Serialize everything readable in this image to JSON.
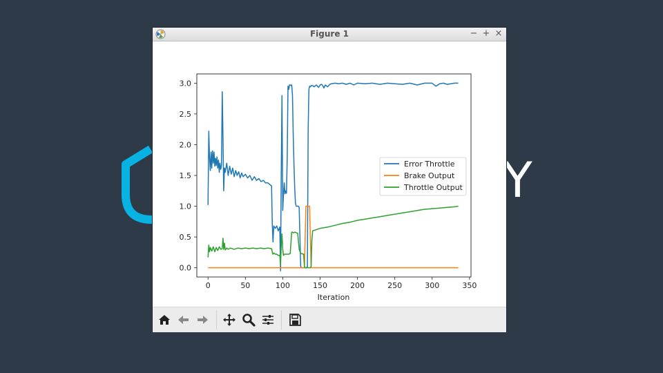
{
  "background": {
    "color": "#2e3a48",
    "brand_letter": "Y",
    "brand_accent": "#08b2e3"
  },
  "window": {
    "title": "Figure 1",
    "controls": {
      "minimize": "−",
      "maximize": "+",
      "close": "×"
    }
  },
  "toolbar": {
    "buttons": [
      "home-icon",
      "back-icon",
      "forward-icon",
      "pan-icon",
      "zoom-icon",
      "configure-subplots-icon",
      "save-icon"
    ]
  },
  "chart_data": {
    "type": "line",
    "title": "",
    "xlabel": "Iteration",
    "ylabel": "",
    "xlim": [
      -15,
      352
    ],
    "ylim": [
      -0.15,
      3.15
    ],
    "xticks": [
      0,
      50,
      100,
      150,
      200,
      250,
      300,
      350
    ],
    "yticks": [
      0.0,
      0.5,
      1.0,
      1.5,
      2.0,
      2.5,
      3.0
    ],
    "xtick_labels": [
      "0",
      "50",
      "100",
      "150",
      "200",
      "250",
      "300",
      "350"
    ],
    "ytick_labels": [
      "0.0",
      "0.5",
      "1.0",
      "1.5",
      "2.0",
      "2.5",
      "3.0"
    ],
    "legend_position": "center-right",
    "grid": false,
    "series": [
      {
        "name": "Error Throttle",
        "color": "#1f77b4",
        "x": [
          0,
          1,
          2,
          3,
          4,
          5,
          6,
          7,
          8,
          9,
          10,
          11,
          12,
          13,
          14,
          15,
          16,
          17,
          18,
          19,
          20,
          21,
          22,
          23,
          25,
          27,
          29,
          31,
          33,
          35,
          37,
          39,
          41,
          43,
          45,
          47,
          50,
          53,
          56,
          59,
          62,
          65,
          68,
          71,
          74,
          77,
          80,
          83,
          85,
          86,
          87,
          88,
          90,
          92,
          94,
          96,
          97,
          98,
          99,
          100,
          101,
          102,
          103,
          104,
          105,
          106,
          107,
          108,
          109,
          110,
          111,
          112,
          113,
          114,
          115,
          116,
          117,
          118,
          119,
          120,
          121,
          122,
          123,
          124,
          125,
          126,
          127,
          128,
          129,
          130,
          131,
          132,
          133,
          134,
          135,
          136,
          137,
          138,
          140,
          142,
          145,
          148,
          150,
          152,
          154,
          155,
          157,
          160,
          163,
          165,
          170,
          175,
          180,
          185,
          190,
          195,
          200,
          210,
          220,
          230,
          240,
          250,
          260,
          270,
          280,
          290,
          300,
          305,
          310,
          315,
          320,
          325,
          330,
          335
        ],
        "y": [
          1.02,
          2.22,
          1.8,
          1.58,
          1.88,
          1.62,
          1.9,
          1.7,
          1.88,
          1.65,
          1.78,
          1.66,
          1.8,
          1.62,
          1.75,
          1.55,
          1.7,
          1.6,
          1.66,
          2.86,
          2.1,
          1.25,
          1.62,
          1.55,
          1.7,
          1.5,
          1.65,
          1.52,
          1.62,
          1.48,
          1.58,
          1.5,
          1.56,
          1.46,
          1.54,
          1.48,
          1.52,
          1.46,
          1.5,
          1.42,
          1.48,
          1.42,
          1.45,
          1.4,
          1.42,
          1.38,
          1.38,
          1.35,
          1.33,
          0.7,
          0.42,
          0.68,
          0.64,
          0.68,
          0.6,
          0.66,
          -0.05,
          1.5,
          2.8,
          0.93,
          1.2,
          1.38,
          1.2,
          1.25,
          1.21,
          1.8,
          2.95,
          2.9,
          2.97,
          2.97,
          2.96,
          2.97,
          2.8,
          2.2,
          1.7,
          1.3,
          1.05,
          1.0,
          1.0,
          1.0,
          1.0,
          0.98,
          0.5,
          0.02,
          0.0,
          0.0,
          0.0,
          0.0,
          0.0,
          0.0,
          0.0,
          0.0,
          0.02,
          2.25,
          2.9,
          2.95,
          2.94,
          2.96,
          2.96,
          2.94,
          2.97,
          2.93,
          2.97,
          2.98,
          2.95,
          2.92,
          2.97,
          2.94,
          2.98,
          2.99,
          3.0,
          2.99,
          3.0,
          2.98,
          3.0,
          2.97,
          3.0,
          2.99,
          3.0,
          2.98,
          3.0,
          2.99,
          2.98,
          3.0,
          2.97,
          3.0,
          3.0,
          2.95,
          2.99,
          3.0,
          2.98,
          2.99,
          3.0,
          3.0
        ]
      },
      {
        "name": "Brake Output",
        "color": "#ff7f0e",
        "x": [
          0,
          129,
          130,
          131,
          136,
          137,
          138,
          335
        ],
        "y": [
          0.0,
          0.0,
          0.5,
          1.0,
          1.0,
          0.5,
          0.0,
          0.0
        ]
      },
      {
        "name": "Throttle Output",
        "color": "#2ca02c",
        "x": [
          0,
          1,
          2,
          3,
          5,
          7,
          9,
          11,
          13,
          15,
          17,
          19,
          20,
          21,
          22,
          23,
          25,
          27,
          30,
          35,
          40,
          45,
          50,
          55,
          60,
          65,
          70,
          75,
          80,
          85,
          86,
          87,
          88,
          90,
          92,
          94,
          96,
          97,
          98,
          99,
          100,
          101,
          102,
          104,
          106,
          108,
          110,
          112,
          113,
          114,
          115,
          116,
          118,
          120,
          122,
          124,
          126,
          127,
          128,
          129,
          130,
          131,
          132,
          134,
          136,
          137,
          138,
          139,
          140,
          145,
          150,
          160,
          170,
          180,
          190,
          200,
          210,
          220,
          230,
          240,
          250,
          260,
          270,
          280,
          290,
          300,
          310,
          320,
          330,
          335
        ],
        "y": [
          0.17,
          0.37,
          0.26,
          0.33,
          0.27,
          0.34,
          0.26,
          0.33,
          0.28,
          0.34,
          0.3,
          0.31,
          0.48,
          0.3,
          0.4,
          0.29,
          0.32,
          0.3,
          0.32,
          0.3,
          0.32,
          0.31,
          0.32,
          0.31,
          0.32,
          0.31,
          0.32,
          0.31,
          0.32,
          0.31,
          0.25,
          0.22,
          0.24,
          0.22,
          0.22,
          0.2,
          0.2,
          0.05,
          0.35,
          0.55,
          0.3,
          0.2,
          0.22,
          0.22,
          0.22,
          0.22,
          0.23,
          0.58,
          0.58,
          0.57,
          0.57,
          0.58,
          0.57,
          0.56,
          0.3,
          0.23,
          0.23,
          0.22,
          0.22,
          0.02,
          0.0,
          0.0,
          0.0,
          0.0,
          0.0,
          0.0,
          0.02,
          0.45,
          0.6,
          0.62,
          0.64,
          0.66,
          0.69,
          0.72,
          0.74,
          0.77,
          0.79,
          0.81,
          0.83,
          0.85,
          0.87,
          0.89,
          0.91,
          0.93,
          0.95,
          0.96,
          0.97,
          0.98,
          0.99,
          1.0
        ]
      }
    ]
  }
}
